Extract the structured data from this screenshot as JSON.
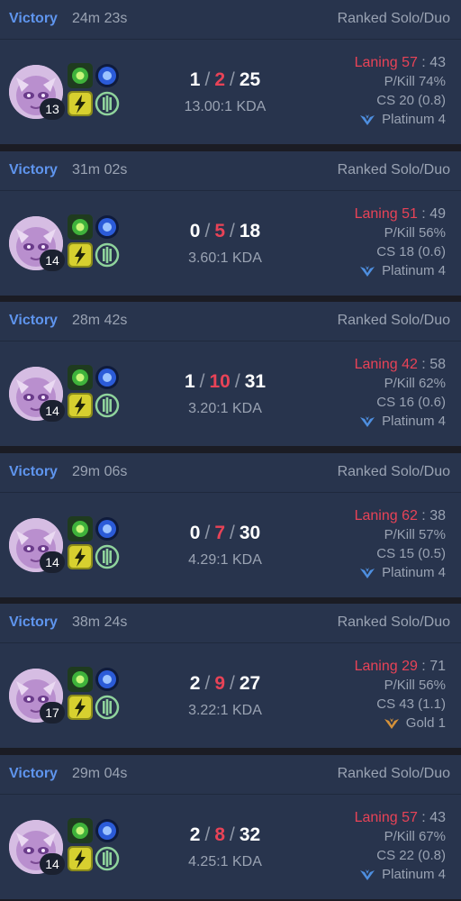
{
  "matches": [
    {
      "result": "Victory",
      "duration": "24m 23s",
      "queue": "Ranked Solo/Duo",
      "level": "13",
      "kills": "1",
      "deaths": "2",
      "assists": "25",
      "kda": "13.00:1 KDA",
      "laning_label": "Laning",
      "laning_a": "57",
      "laning_b": "43",
      "pkill": "P/Kill 74%",
      "cs": "CS 20 (0.8)",
      "tier": "Platinum 4",
      "tier_color": "#4e8fe0"
    },
    {
      "result": "Victory",
      "duration": "31m 02s",
      "queue": "Ranked Solo/Duo",
      "level": "14",
      "kills": "0",
      "deaths": "5",
      "assists": "18",
      "kda": "3.60:1 KDA",
      "laning_label": "Laning",
      "laning_a": "51",
      "laning_b": "49",
      "pkill": "P/Kill 56%",
      "cs": "CS 18 (0.6)",
      "tier": "Platinum 4",
      "tier_color": "#4e8fe0"
    },
    {
      "result": "Victory",
      "duration": "28m 42s",
      "queue": "Ranked Solo/Duo",
      "level": "14",
      "kills": "1",
      "deaths": "10",
      "assists": "31",
      "kda": "3.20:1 KDA",
      "laning_label": "Laning",
      "laning_a": "42",
      "laning_b": "58",
      "pkill": "P/Kill 62%",
      "cs": "CS 16 (0.6)",
      "tier": "Platinum 4",
      "tier_color": "#4e8fe0"
    },
    {
      "result": "Victory",
      "duration": "29m 06s",
      "queue": "Ranked Solo/Duo",
      "level": "14",
      "kills": "0",
      "deaths": "7",
      "assists": "30",
      "kda": "4.29:1 KDA",
      "laning_label": "Laning",
      "laning_a": "62",
      "laning_b": "38",
      "pkill": "P/Kill 57%",
      "cs": "CS 15 (0.5)",
      "tier": "Platinum 4",
      "tier_color": "#4e8fe0"
    },
    {
      "result": "Victory",
      "duration": "38m 24s",
      "queue": "Ranked Solo/Duo",
      "level": "17",
      "kills": "2",
      "deaths": "9",
      "assists": "27",
      "kda": "3.22:1 KDA",
      "laning_label": "Laning",
      "laning_a": "29",
      "laning_b": "71",
      "pkill": "P/Kill 56%",
      "cs": "CS 43 (1.1)",
      "tier": "Gold 1",
      "tier_color": "#d4913a"
    },
    {
      "result": "Victory",
      "duration": "29m 04s",
      "queue": "Ranked Solo/Duo",
      "level": "14",
      "kills": "2",
      "deaths": "8",
      "assists": "32",
      "kda": "4.25:1 KDA",
      "laning_label": "Laning",
      "laning_a": "57",
      "laning_b": "43",
      "pkill": "P/Kill 67%",
      "cs": "CS 22 (0.8)",
      "tier": "Platinum 4",
      "tier_color": "#4e8fe0"
    }
  ],
  "icons": {
    "champion": "champion-portrait-icon",
    "spell1": "green-rune-icon",
    "spell2": "blue-orb-icon",
    "spell3": "flash-spell-icon",
    "spell4": "resolve-rune-icon",
    "tier": "rank-wings-icon"
  },
  "colors": {
    "victory": "#5f95ee",
    "deaths": "#e84357",
    "card_bg": "#28344d",
    "page_bg": "#1b1c24"
  }
}
